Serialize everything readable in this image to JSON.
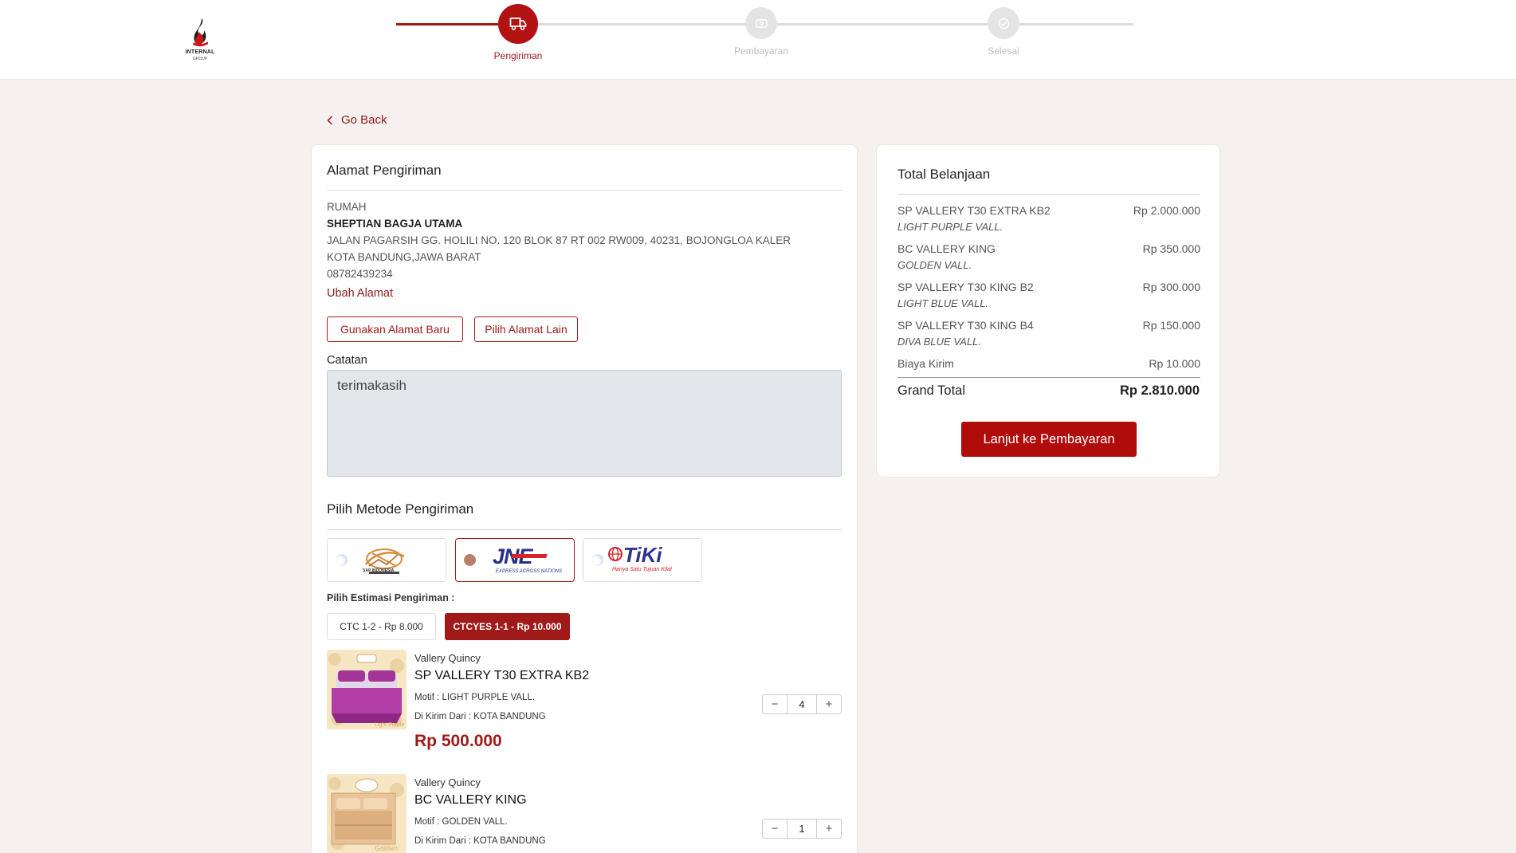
{
  "logo": {
    "line1": "INTERNAL",
    "line2": "GROUP"
  },
  "stepper": {
    "steps": [
      {
        "label": "Pengiriman",
        "icon": "truck-icon",
        "state": "active"
      },
      {
        "label": "Pembayaran",
        "icon": "wallet-icon",
        "state": "inactive"
      },
      {
        "label": "Selesai",
        "icon": "check-circle-icon",
        "state": "inactive"
      }
    ]
  },
  "colors": {
    "brand": "#a11a1a",
    "button": "#b00c0c",
    "background": "#f6f1ee"
  },
  "nav": {
    "go_back": "Go Back"
  },
  "address": {
    "title": "Alamat Pengiriman",
    "label": "RUMAH",
    "name": "SHEPTIAN BAGJA UTAMA",
    "street": "JALAN PAGARSIH GG. HOLILI NO. 120 BLOK 87 RT 002 RW009, 40231, BOJONGLOA KALER",
    "city": "KOTA BANDUNG,JAWA BARAT",
    "phone": "08782439234",
    "change_link": "Ubah Alamat",
    "new_address_button": "Gunakan Alamat Baru",
    "other_address_button": "Pilih Alamat Lain"
  },
  "notes": {
    "label": "Catatan",
    "value": "terimakasih"
  },
  "shipping": {
    "title": "Pilih Metode Pengiriman",
    "couriers": [
      {
        "name": "SAP INDONESIA",
        "selected": false
      },
      {
        "name": "JNE",
        "tagline": "EXPRESS ACROSS NATIONS",
        "selected": true
      },
      {
        "name": "TiKi",
        "tagline": "Hanya Satu Tujuan Kilat",
        "selected": false
      }
    ],
    "estimate_label": "Pilih Estimasi Pengiriman :",
    "options": [
      {
        "label": "CTC 1-2 - Rp 8.000",
        "selected": false
      },
      {
        "label": "CTCYES 1-1 - Rp 10.000",
        "selected": true
      }
    ]
  },
  "products": [
    {
      "brand": "Vallery Quincy",
      "name": "SP VALLERY T30 EXTRA KB2",
      "motif": "Motif : LIGHT PURPLE VALL.",
      "origin": "Di Kirim Dari : KOTA BANDUNG",
      "price": "Rp 500.000",
      "qty": "4"
    },
    {
      "brand": "Vallery Quincy",
      "name": "BC VALLERY KING",
      "motif": "Motif : GOLDEN VALL.",
      "origin": "Di Kirim Dari : KOTA BANDUNG",
      "qty": "1"
    }
  ],
  "summary": {
    "title": "Total Belanjaan",
    "items": [
      {
        "name": "SP VALLERY T30 EXTRA KB2",
        "variant": "LIGHT PURPLE VALL.",
        "price": "Rp 2.000.000"
      },
      {
        "name": "BC VALLERY KING",
        "variant": "GOLDEN VALL.",
        "price": "Rp 350.000"
      },
      {
        "name": "SP VALLERY T30 KING B2",
        "variant": "LIGHT BLUE VALL.",
        "price": "Rp 300.000"
      },
      {
        "name": "SP VALLERY T30 KING B4",
        "variant": "DIVA BLUE VALL.",
        "price": "Rp 150.000"
      }
    ],
    "shipping_label": "Biaya Kirim",
    "shipping_price": "Rp 10.000",
    "grand_label": "Grand Total",
    "grand_value": "Rp 2.810.000",
    "pay_button": "Lanjut ke Pembayaran"
  }
}
